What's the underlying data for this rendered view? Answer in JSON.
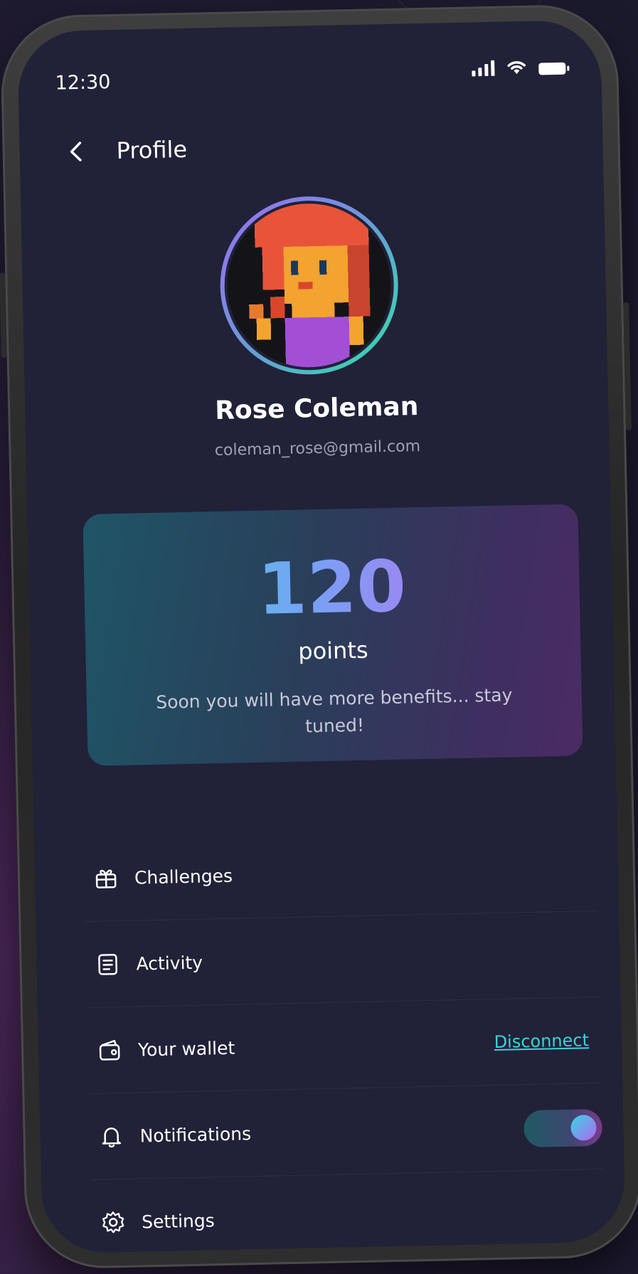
{
  "status_bar": {
    "time": "12:30"
  },
  "header": {
    "title": "Profile"
  },
  "user": {
    "name": "Rose Coleman",
    "email": "coleman_rose@gmail.com"
  },
  "points_card": {
    "value": "120",
    "label": "points",
    "note": "Soon you will have more benefits... stay tuned!"
  },
  "menu": {
    "items": [
      {
        "label": "Challenges",
        "icon": "gift-icon"
      },
      {
        "label": "Activity",
        "icon": "document-list-icon"
      },
      {
        "label": "Your wallet",
        "icon": "wallet-icon",
        "action": "Disconnect"
      },
      {
        "label": "Notifications",
        "icon": "bell-icon",
        "toggle": true
      },
      {
        "label": "Settings",
        "icon": "gear-icon"
      }
    ]
  },
  "colors": {
    "screen_bg": "#212138",
    "accent_cyan": "#39d4d8",
    "accent_purple": "#d65ce8"
  }
}
